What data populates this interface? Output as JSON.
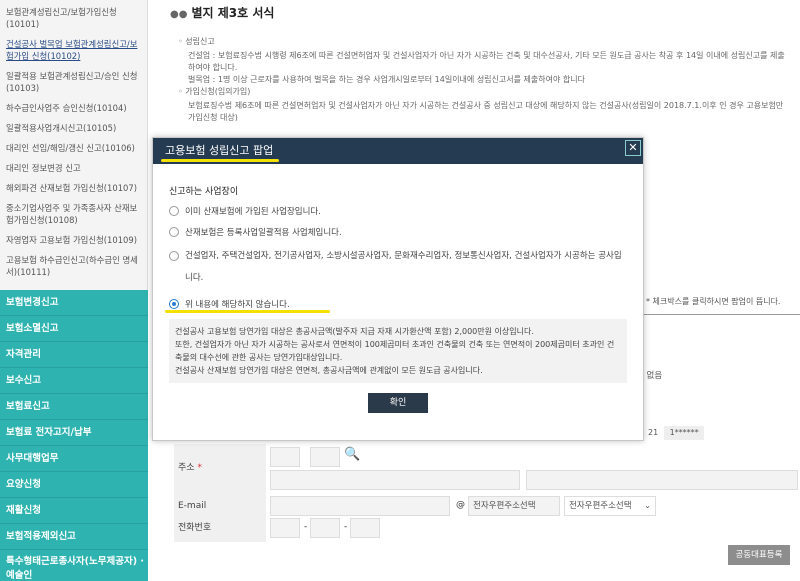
{
  "sidebar": {
    "sub_items": [
      {
        "label": "보험관계성립신고/보험가입신청 (10101)",
        "active": false
      },
      {
        "label": "건설공사 벌목업 보험관계성립신고/보험가입 신청(10102)",
        "active": true
      },
      {
        "label": "일괄적용 보험관계성립신고/승인 신청(10103)",
        "active": false
      },
      {
        "label": "하수급인사업주 승인신청(10104)",
        "active": false
      },
      {
        "label": "일괄적용사업개시신고(10105)",
        "active": false
      },
      {
        "label": "대리인 선임/해임/갱신 신고(10106)",
        "active": false
      },
      {
        "label": "대리인 정보변경 신고",
        "active": false
      },
      {
        "label": "해외파견 산재보험 가입신청(10107)",
        "active": false
      },
      {
        "label": "중소기업사업주 및 가족종사자 산재보험가입신청(10108)",
        "active": false
      },
      {
        "label": "자영업자 고용보험 가입신청(10109)",
        "active": false
      },
      {
        "label": "고용보험 하수급인신고(하수급인 명세서)(10111)",
        "active": false
      }
    ],
    "main_items": [
      "보험변경신고",
      "보험소멸신고",
      "자격관리",
      "보수신고",
      "보험료신고",
      "보험료 전자고지/납부",
      "사무대행업무",
      "요양신청",
      "재활신청",
      "보험적용제외신고",
      "특수형태근로종사자(노무제공자) · 예술인"
    ]
  },
  "background": {
    "title": "별지 제3호 서식",
    "block1_head": "◦ 성립신고",
    "block1_line1": "건설업 : 보험료징수법 시행령 제6조에 따른 건설면허업자 및 건설사업자가 아닌 자가 시공하는 건축 및 대수선공사, 기타 모든 원도급 공사는 착공 후 14일 이내에 성립신고를 제출하여야 합니다.",
    "block1_line2": "벌목업 : 1명 이상 근로자를 사용하여 벌목을 하는 경우 사업개시일로부터 14일이내에 성립신고서를 제출하여야 합니다",
    "block2_head": "◦ 가입신청(임의가입)",
    "block2_line1": "보험료징수법 제6조에 따른 건설면허업자 및 건설사업자가 아닌 자가 시공하는 건설공사 중 성립신고 대상에 해당하지 않는 건설공사(성립일이 2018.7.1.이후 인 경우 고용보험만 가입신청 대상)",
    "note": "* 체크박스를 클릭하시면 팝업이 뜹니다.",
    "radio_text": "있음  ◯ 없음",
    "id_prefix": "21",
    "id_masked": "1******",
    "address_label": "주소",
    "email_label": "E-mail",
    "email_at": "@",
    "email_domain_placeholder": "전자우편주소선택",
    "email_select": "전자우편주소선택",
    "phone_label": "전화번호",
    "phone_dash": "-",
    "rep_button": "공동대표등록"
  },
  "modal": {
    "title": "고용보험 성립신고 팝업",
    "close": "✕",
    "question": "신고하는 사업장이",
    "options": [
      {
        "text": "이미 산재보험에 가입된 사업장입니다.",
        "checked": false
      },
      {
        "text": "산재보험은 등록사업일괄적용 사업체입니다.",
        "checked": false
      },
      {
        "text": "건설업자, 주택건설업자, 전기공사업자, 소방시설공사업자, 문화재수리업자, 정보통신사업자, 건설사업자가 시공하는 공사입니다.",
        "checked": false
      },
      {
        "text": "위 내용에 해당하지 않습니다.",
        "checked": true
      }
    ],
    "info_lines": [
      "건설공사 고용보험 당연가입 대상은 총공사금액(발주자 지급 자재 시가환산액 포함) 2,000만원 이상입니다.",
      "또한, 건설업자가 아닌 자가 시공하는 공사로서 연면적이 100제곱미터 초과인 건축물의 건축 또는 연면적이 200제곱미터 초과인 건축물의 대수선에 관한 공사는 당연가입대상입니다.",
      "건설공사 산재보험 당연가입 대상은 연면적, 총공사금액에 관계없이 모든 원도급 공사입니다."
    ],
    "confirm": "확인"
  },
  "colors": {
    "sidebar_accent": "#2fb3b0",
    "modal_header": "#243b52",
    "highlight": "#f2e000"
  }
}
